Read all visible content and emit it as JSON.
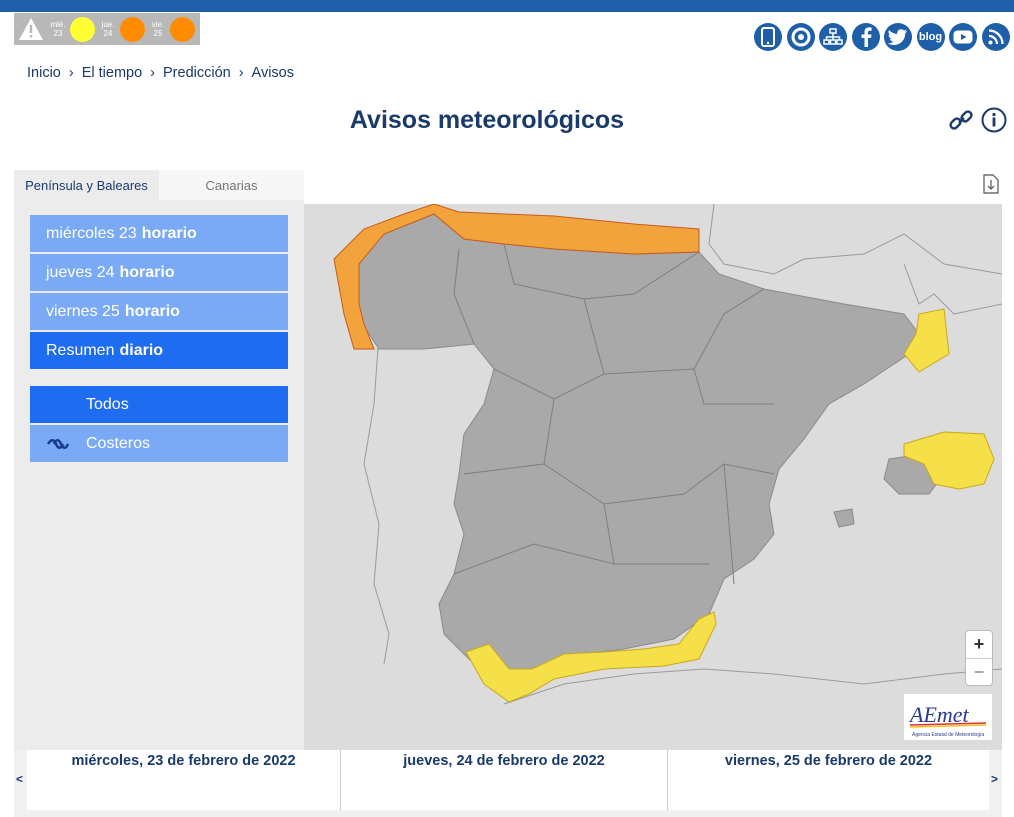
{
  "warning_strip": {
    "days": [
      {
        "label_day": "mié.",
        "label_num": "23",
        "level_color": "#ffff33"
      },
      {
        "label_day": "jue.",
        "label_num": "24",
        "level_color": "#ff8c00"
      },
      {
        "label_day": "vie.",
        "label_num": "25",
        "level_color": "#ff8c00"
      }
    ]
  },
  "social": {
    "blog_label": "blog",
    "icons": [
      "mobile-icon",
      "lifebuoy-icon",
      "sitemap-icon",
      "facebook-icon",
      "twitter-icon",
      "blog-icon",
      "youtube-icon",
      "rss-icon"
    ]
  },
  "breadcrumb": {
    "items": [
      "Inicio",
      "El tiempo",
      "Predicción",
      "Avisos"
    ],
    "separator": "›"
  },
  "page": {
    "title": "Avisos meteorológicos"
  },
  "sidebar": {
    "tabs": [
      {
        "label": "Península y Baleares",
        "active": true
      },
      {
        "label": "Canarias",
        "active": false
      }
    ],
    "day_buttons": [
      {
        "label": "miércoles 23",
        "bold": "horario"
      },
      {
        "label": "jueves 24",
        "bold": "horario"
      },
      {
        "label": "viernes 25",
        "bold": "horario"
      },
      {
        "label": "Resumen",
        "bold": "diario"
      }
    ],
    "filters": [
      {
        "label": "Todos"
      },
      {
        "label": "Costeros"
      }
    ]
  },
  "map": {
    "zoom_in": "+",
    "zoom_out": "−",
    "logo_text": "AEmet",
    "logo_sub": "Agencia Estatal de Meteorología",
    "colors": {
      "sea": "#dcdcdc",
      "land": "#a9a9a9",
      "yellow": "#f5e04a",
      "orange": "#f2a33c"
    }
  },
  "bottom": {
    "prev": "<",
    "next": ">",
    "days": [
      "miércoles, 23 de febrero de 2022",
      "jueves, 24 de febrero de 2022",
      "viernes, 25 de febrero de 2022"
    ]
  }
}
